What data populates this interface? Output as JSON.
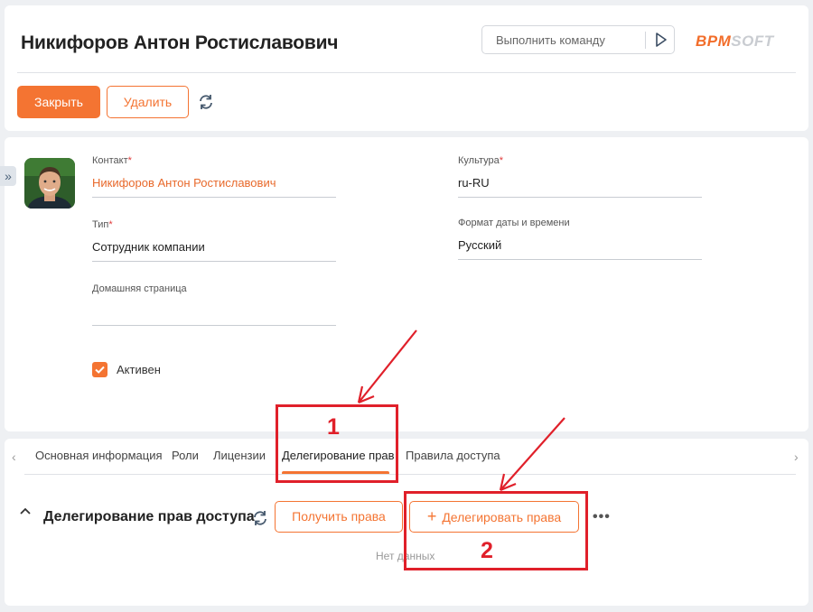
{
  "header": {
    "title": "Никифоров Антон Ростиславович",
    "command_placeholder": "Выполнить команду",
    "logo_left": "BPM",
    "logo_right": "SOFT",
    "close_label": "Закрыть",
    "delete_label": "Удалить"
  },
  "card": {
    "fields": {
      "contact": {
        "label": "Контакт",
        "required": "*",
        "value": "Никифоров Антон Ростиславович"
      },
      "type": {
        "label": "Тип",
        "required": "*",
        "value": "Сотрудник компании"
      },
      "homepage": {
        "label": "Домашняя страница",
        "value": ""
      },
      "culture": {
        "label": "Культура",
        "required": "*",
        "value": "ru-RU"
      },
      "datetime_format": {
        "label": "Формат даты и времени",
        "value": "Русский"
      }
    },
    "active": {
      "label": "Активен",
      "checked": true
    }
  },
  "tabs": [
    {
      "label": "Основная информация"
    },
    {
      "label": "Роли"
    },
    {
      "label": "Лицензии"
    },
    {
      "label": "Делегирование прав",
      "active": true
    },
    {
      "label": "Правила доступа"
    }
  ],
  "detail": {
    "title": "Делегирование прав доступа",
    "get_rights_label": "Получить права",
    "delegate_label": "Делегировать права",
    "delegate_plus": "+",
    "empty_text": "Нет данных"
  },
  "annotations": {
    "label1": "1",
    "label2": "2"
  },
  "colors": {
    "accent": "#f47432",
    "annotation": "#e0202a"
  }
}
